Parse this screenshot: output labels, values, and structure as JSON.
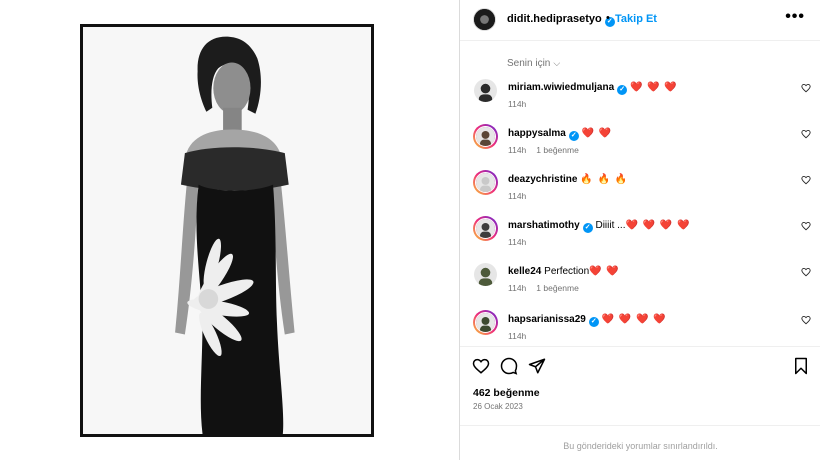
{
  "post": {
    "owner": "didit.hediprasetyo",
    "owner_verified": true,
    "separator": "•",
    "follow_label": "Takip Et",
    "more_label": "•••",
    "image_alt": "Black and white fashion photo of a woman in an off-shoulder black dress with white flower print"
  },
  "comments_sort": "Senin için",
  "comments": [
    {
      "user": "miriam.wiwiedmuljana",
      "verified": true,
      "text": "",
      "hearts": "❤️ ❤️ ❤️",
      "age": "114h",
      "likes": ""
    },
    {
      "user": "happysalma",
      "verified": true,
      "text": "",
      "hearts": "❤️ ❤️",
      "age": "114h",
      "likes": "1 beğenme"
    },
    {
      "user": "deazychristine",
      "verified": false,
      "text": "",
      "hearts": "🔥 🔥 🔥",
      "age": "114h",
      "likes": ""
    },
    {
      "user": "marshatimothy",
      "verified": true,
      "text": "Diiiit ...",
      "hearts": "❤️ ❤️ ❤️ ❤️",
      "age": "114h",
      "likes": ""
    },
    {
      "user": "kelle24",
      "verified": false,
      "text": "Perfection",
      "hearts": "❤️ ❤️",
      "age": "114h",
      "likes": "1 beğenme"
    },
    {
      "user": "hapsarianissa29",
      "verified": true,
      "text": "",
      "hearts": "❤️ ❤️ ❤️ ❤️",
      "age": "114h",
      "likes": ""
    }
  ],
  "likes_count": "462 beğenme",
  "date": "26 Ocak 2023",
  "comments_limited": "Bu gönderideki yorumlar sınırlandırıldı.",
  "colors": {
    "accent": "#0095f6",
    "heart": "#e0245e",
    "muted": "#737373"
  }
}
